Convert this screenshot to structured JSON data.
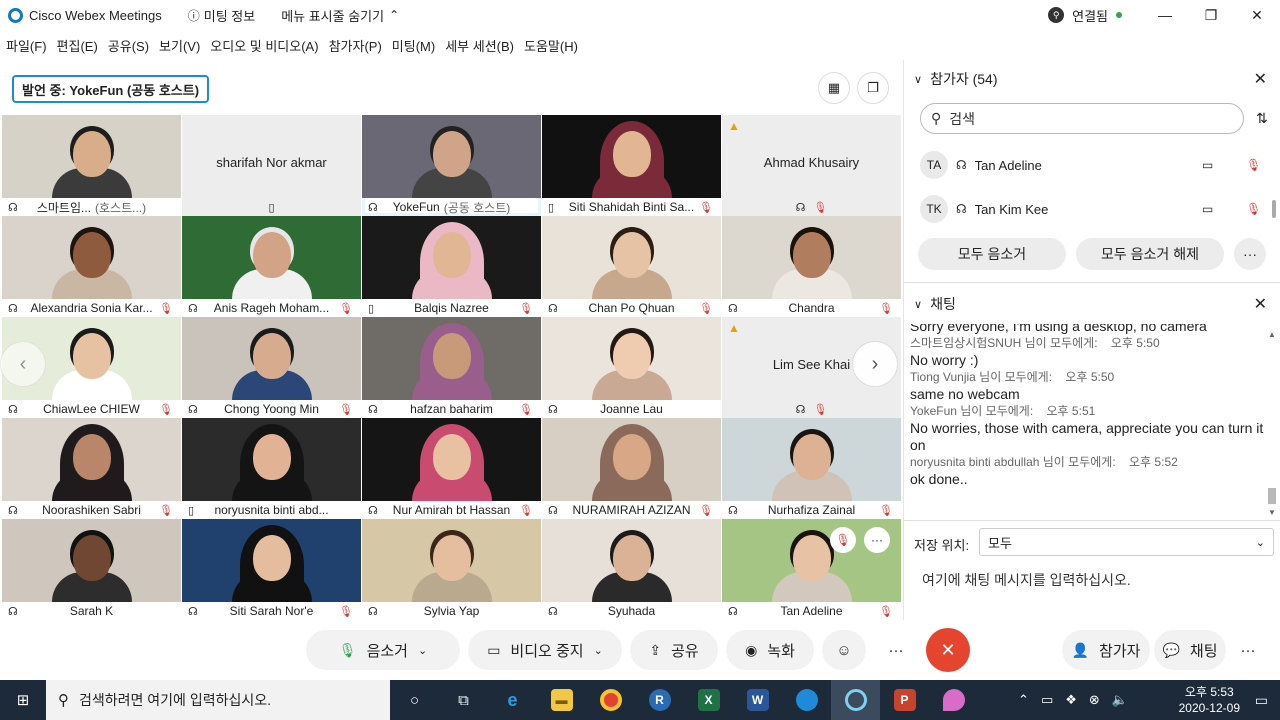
{
  "titlebar": {
    "app_name": "Cisco Webex Meetings",
    "meeting_info": "미팅 정보",
    "hide_menu": "메뉴 표시줄 숨기기",
    "status": "연결됨"
  },
  "menu": [
    "파일(F)",
    "편집(E)",
    "공유(S)",
    "보기(V)",
    "오디오 및 비디오(A)",
    "참가자(P)",
    "미팅(M)",
    "세부 세션(B)",
    "도움말(H)"
  ],
  "stage": {
    "speaker_label": "발언 중: YokeFun (공동 호스트)"
  },
  "tiles": [
    {
      "name": "스마트임...",
      "sub": "(호스트...)",
      "type": "video",
      "bg": "#d6d2c8",
      "skin": "#d8ad8a",
      "top": "#1d1d1d",
      "cloth": "#3b3b3b",
      "left_icon": "host-audio-icon",
      "mic": false
    },
    {
      "name": "sharifah Nor akmar",
      "type": "blank",
      "cap_icon": "phone-icon"
    },
    {
      "name": "YokeFun",
      "sub": "(공동 호스트)",
      "type": "video",
      "bg": "#6a6874",
      "skin": "#cfa489",
      "top": "#222",
      "cloth": "#444",
      "active": true,
      "mic": false
    },
    {
      "name": "Siti Shahidah Binti Sa...",
      "type": "video",
      "bg": "#111111",
      "skin": "#e2b693",
      "top": "#7a2a39",
      "cloth": "#7a2a39",
      "hijab": true,
      "left_icon": "phone-icon",
      "mic": true
    },
    {
      "name": "Ahmad Khusairy",
      "type": "blank",
      "warn": true,
      "mic": true
    },
    {
      "name": "Alexandria Sonia Kar...",
      "type": "video",
      "bg": "#d9d3cc",
      "skin": "#8e5b3e",
      "top": "#1e1410",
      "cloth": "#c9b7a3",
      "mic": true
    },
    {
      "name": "Anis Rageh Moham...",
      "type": "video",
      "bg": "#2f6b35",
      "skin": "#d2a387",
      "top": "#e6e6e6",
      "cloth": "#f0f0f0",
      "mic": true
    },
    {
      "name": "Balqis Nazree",
      "type": "video",
      "bg": "#1a1a1a",
      "skin": "#e0b695",
      "top": "#eab9c5",
      "cloth": "#eab9c5",
      "hijab": true,
      "left_icon": "phone-icon",
      "mic": true
    },
    {
      "name": "Chan Po Qhuan",
      "type": "video",
      "bg": "#e8e2d9",
      "skin": "#e7c3a5",
      "top": "#2b1d14",
      "cloth": "#c7a88d",
      "mic": true
    },
    {
      "name": "Chandra",
      "type": "video",
      "bg": "#ddd8cf",
      "skin": "#b07e5e",
      "top": "#1c120c",
      "cloth": "#ece7e0",
      "mic": true
    },
    {
      "name": "ChiawLee CHIEW",
      "type": "video",
      "bg": "#e6ecda",
      "skin": "#e7c2a2",
      "top": "#1a1a1a",
      "cloth": "#ffffff",
      "mic": true
    },
    {
      "name": "Chong Yoong Min",
      "type": "video",
      "bg": "#c9c3bb",
      "skin": "#d7ac8e",
      "top": "#1b1b1b",
      "cloth": "#2b4778",
      "mic": true
    },
    {
      "name": "hafzan baharim",
      "type": "video",
      "bg": "#6f6b67",
      "skin": "#c99a7a",
      "top": "#9a5e8c",
      "cloth": "#9a5e8c",
      "hijab": true,
      "mic": true
    },
    {
      "name": "Joanne Lau",
      "type": "video",
      "bg": "#ebe4dd",
      "skin": "#efcbb0",
      "top": "#231813",
      "cloth": "#c9a994",
      "mic": false
    },
    {
      "name": "Lim See Khai",
      "type": "blank",
      "warn": true,
      "mic": true
    },
    {
      "name": "Noorashiken Sabri",
      "type": "video",
      "bg": "#dcd5cd",
      "skin": "#b9866a",
      "top": "#1f1a1c",
      "cloth": "#1f1a1c",
      "hijab": true,
      "mic": true
    },
    {
      "name": "noryusnita binti abd...",
      "type": "video",
      "bg": "#2b2b2b",
      "skin": "#e1b294",
      "top": "#141414",
      "cloth": "#141414",
      "hijab": true,
      "left_icon": "phone-icon",
      "mic": false
    },
    {
      "name": "Nur Amirah bt Hassan",
      "type": "video",
      "bg": "#151515",
      "skin": "#e8c0a2",
      "top": "#c94b6f",
      "cloth": "#c94b6f",
      "hijab": true,
      "mic": true
    },
    {
      "name": "NURAMIRAH AZIZAN",
      "type": "video",
      "bg": "#d7cfc4",
      "skin": "#d8a886",
      "top": "#8b6a5c",
      "cloth": "#8b6a5c",
      "hijab": true,
      "mic": true
    },
    {
      "name": "Nurhafiza Zainal",
      "type": "video",
      "bg": "#cdd7d9",
      "skin": "#ddb294",
      "top": "#1b1511",
      "cloth": "#d0c2b6",
      "mic": true
    },
    {
      "name": "Sarah K",
      "type": "video",
      "bg": "#cfc6bd",
      "skin": "#6f4732",
      "top": "#111111",
      "cloth": "#2d2d2d",
      "mic": false
    },
    {
      "name": "Siti Sarah Nor'e",
      "type": "video",
      "bg": "#20406e",
      "skin": "#e4bc9e",
      "top": "#111111",
      "cloth": "#111111",
      "hijab": true,
      "mic": true
    },
    {
      "name": "Sylvia Yap",
      "type": "video",
      "bg": "#d6c7a6",
      "skin": "#e4be9e",
      "top": "#3a2718",
      "cloth": "#b8a98f",
      "mic": false
    },
    {
      "name": "Syuhada",
      "type": "video",
      "bg": "#e7e0d8",
      "skin": "#dbb295",
      "top": "#1b1b1b",
      "cloth": "#2a2a2a",
      "mic": false
    },
    {
      "name": "Tan Adeline",
      "type": "video",
      "bg": "#a5c585",
      "skin": "#e8c2a4",
      "top": "#1a130f",
      "cloth": "#d3c8bd",
      "mic": true
    }
  ],
  "toolbar": {
    "mute": "음소거",
    "stop_video": "비디오 중지",
    "share": "공유",
    "record": "녹화",
    "participants": "참가자",
    "chat": "채팅"
  },
  "participants_panel": {
    "title": "참가자 (54)",
    "search_placeholder": "검색",
    "rows": [
      {
        "initials": "TA",
        "name": "Tan Adeline"
      },
      {
        "initials": "TK",
        "name": "Tan Kim Kee"
      }
    ],
    "mute_all": "모두 음소거",
    "unmute_all": "모두 음소거 해제"
  },
  "chat_panel": {
    "title": "채팅",
    "lines": [
      {
        "kind": "msg",
        "text": "Sorry everyone, I'm using a desktop, no camera"
      },
      {
        "kind": "meta",
        "text": "스마트임상시험SNUH 님이 모두에게:",
        "time": "오후 5:50"
      },
      {
        "kind": "msg",
        "text": "No worry :)"
      },
      {
        "kind": "meta",
        "text": "Tiong Vunjia 님이 모두에게:",
        "time": "오후 5:50"
      },
      {
        "kind": "msg",
        "text": "same no webcam"
      },
      {
        "kind": "meta",
        "text": "YokeFun 님이 모두에게:",
        "time": "오후 5:51"
      },
      {
        "kind": "msg",
        "text": "No worries, those with camera, appreciate you can turn it on"
      },
      {
        "kind": "meta",
        "text": "noryusnita binti abdullah 님이 모두에게:",
        "time": "오후 5:52"
      },
      {
        "kind": "msg",
        "text": "ok done.."
      }
    ],
    "save_label": "저장 위치:",
    "save_value": "모두",
    "input_placeholder": "여기에 채팅 메시지를 입력하십시오."
  },
  "taskbar": {
    "search_text": "검색하려면 여기에 입력하십시오.",
    "time": "오후 5:53",
    "date": "2020-12-09"
  },
  "colors": {
    "accent": "#1c8cd8",
    "active_tile": "#1cb4e8",
    "end_call": "#e5452e",
    "muted": "#e03131"
  }
}
